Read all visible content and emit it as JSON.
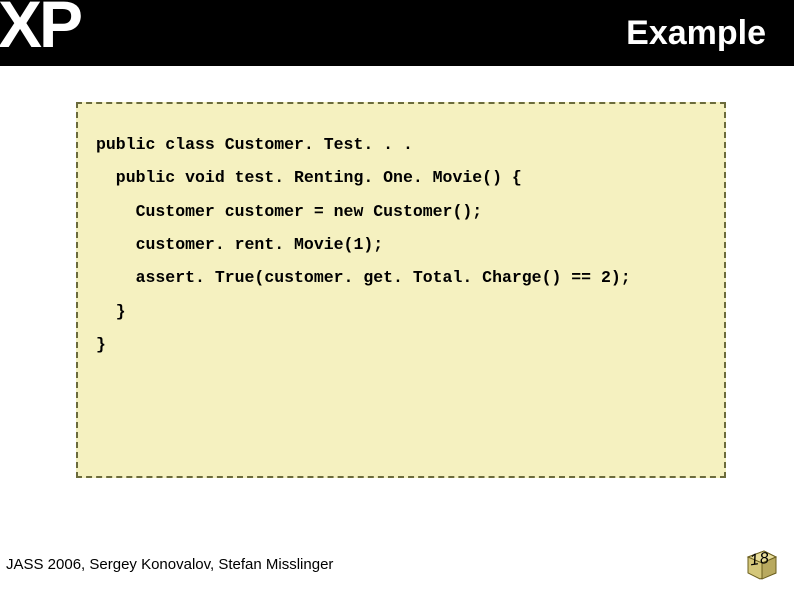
{
  "header": {
    "logo": "XP",
    "title": "Example"
  },
  "code": {
    "line1": "public class Customer. Test. . .",
    "line2": "  public void test. Renting. One. Movie() {",
    "line3": "    Customer customer = new Customer();",
    "line4": "    customer. rent. Movie(1);",
    "line5": "    assert. True(customer. get. Total. Charge() == 2);",
    "line6": "  }",
    "line7": "}"
  },
  "footer": {
    "text": "JASS 2006, Sergey Konovalov, Stefan Misslinger"
  },
  "page": {
    "number": "18"
  }
}
